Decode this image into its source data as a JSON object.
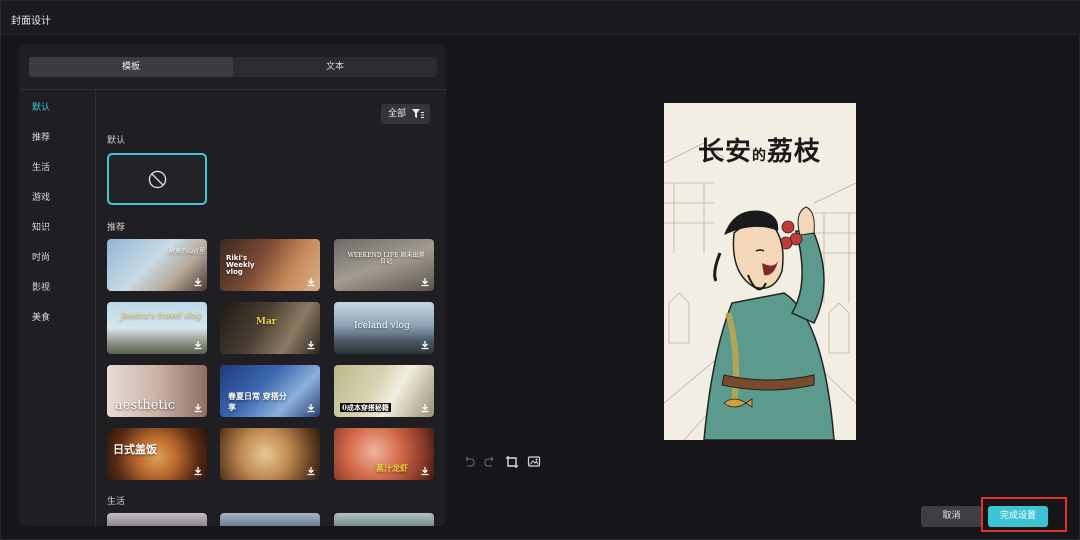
{
  "window": {
    "title": "封面设计"
  },
  "tabs": [
    {
      "label": "模板",
      "active": true
    },
    {
      "label": "文本",
      "active": false
    }
  ],
  "categories": [
    {
      "label": "默认",
      "active": true
    },
    {
      "label": "推荐",
      "active": false
    },
    {
      "label": "生活",
      "active": false
    },
    {
      "label": "游戏",
      "active": false
    },
    {
      "label": "知识",
      "active": false
    },
    {
      "label": "时尚",
      "active": false
    },
    {
      "label": "影视",
      "active": false
    },
    {
      "label": "美食",
      "active": false
    }
  ],
  "filter": {
    "label": "全部",
    "icon": "filter-icon"
  },
  "sections": {
    "default_label": "默认",
    "recommend_label": "推荐",
    "life_label": "生活"
  },
  "templates": [
    {
      "name": "thumb-sea",
      "text": "醒来的山谷里"
    },
    {
      "name": "thumb-weekly",
      "text": "Riki's Weekly vlog"
    },
    {
      "name": "thumb-weekend",
      "text": "WEEKEND LIFE 周末出游日记"
    },
    {
      "name": "thumb-travel",
      "text": "Jessica's travel vlog"
    },
    {
      "name": "thumb-mar-life",
      "text": "Mar Life"
    },
    {
      "name": "thumb-iceland",
      "text": "Iceland vlog"
    },
    {
      "name": "thumb-aesthetic",
      "text": "aesthetic"
    },
    {
      "name": "thumb-spring",
      "text": "春夏日常 穿搭分享"
    },
    {
      "name": "thumb-outfit",
      "text": "0成本穿搭秘籍"
    },
    {
      "name": "thumb-japanese-food",
      "text": "日式盖饭"
    },
    {
      "name": "thumb-pizza",
      "text": ""
    },
    {
      "name": "thumb-seafood",
      "text": "蒸汁龙虾"
    }
  ],
  "preview": {
    "title_left": "长安",
    "title_mid": "的",
    "title_right": "荔枝"
  },
  "buttons": {
    "cancel": "取消",
    "done": "完成设置"
  },
  "colors": {
    "accent": "#3cc3d4",
    "highlight": "#e0312b"
  }
}
